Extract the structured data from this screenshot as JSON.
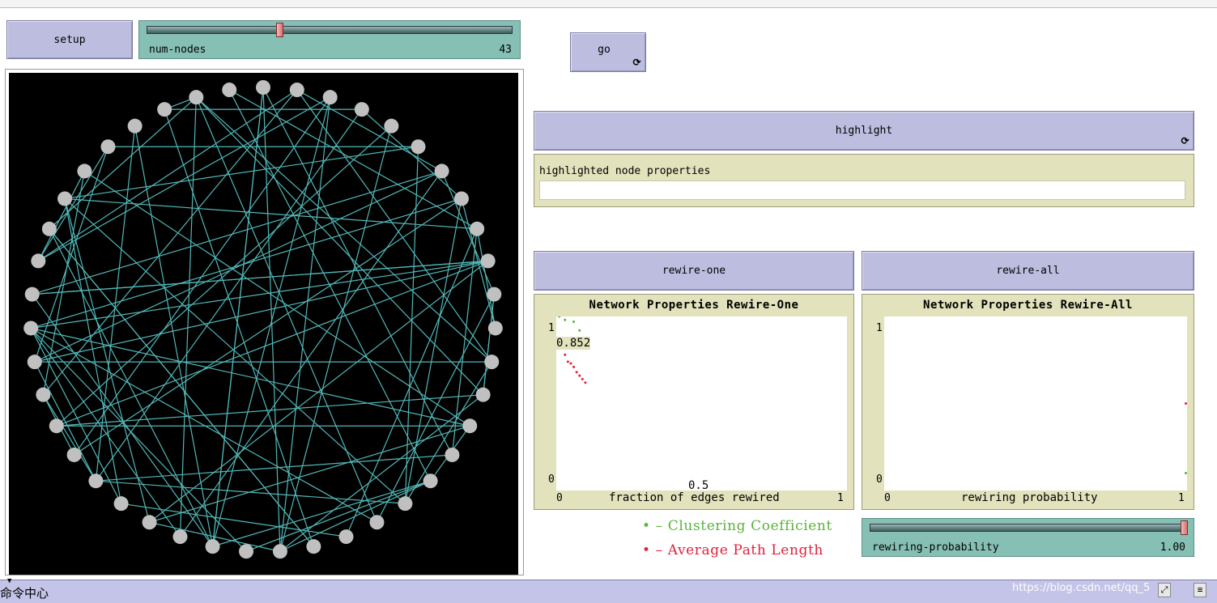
{
  "buttons": {
    "setup": "setup",
    "go": "go",
    "highlight": "highlight",
    "rewire_one": "rewire-one",
    "rewire_all": "rewire-all",
    "forever_icon": "forever-icon"
  },
  "sliders": {
    "num_nodes": {
      "label": "num-nodes",
      "value": "43",
      "fraction": 0.36
    },
    "rewiring_probability": {
      "label": "rewiring-probability",
      "value": "1.00",
      "fraction": 1.0
    }
  },
  "monitor": {
    "label": "highlighted node properties",
    "value": ""
  },
  "plots": [
    {
      "title": "Network Properties Rewire-One",
      "xlabel": "fraction of edges rewired",
      "x_min": "0",
      "x_max": "1",
      "y_min": "0",
      "y_max": "1",
      "annotations": [
        {
          "text": "0.852"
        },
        {
          "text": "0.5"
        }
      ]
    },
    {
      "title": "Network Properties Rewire-All",
      "xlabel": "rewiring probability",
      "x_min": "0",
      "x_max": "1",
      "y_min": "0",
      "y_max": "1"
    }
  ],
  "chart_data": [
    {
      "type": "scatter",
      "title": "Network Properties Rewire-One",
      "xlabel": "fraction of edges rewired",
      "ylabel": "",
      "xlim": [
        0,
        1
      ],
      "ylim": [
        0,
        1
      ],
      "series": [
        {
          "name": "Clustering Coefficient",
          "color": "#59b33c",
          "points": [
            [
              0.01,
              1.0
            ],
            [
              0.03,
              0.98
            ],
            [
              0.06,
              0.97
            ],
            [
              0.08,
              0.92
            ]
          ]
        },
        {
          "name": "Average Path Length",
          "color": "#e0203c",
          "points": [
            [
              0.03,
              0.78
            ],
            [
              0.04,
              0.74
            ],
            [
              0.05,
              0.73
            ],
            [
              0.06,
              0.71
            ],
            [
              0.07,
              0.68
            ],
            [
              0.08,
              0.66
            ],
            [
              0.09,
              0.64
            ],
            [
              0.1,
              0.62
            ]
          ]
        }
      ]
    },
    {
      "type": "scatter",
      "title": "Network Properties Rewire-All",
      "xlabel": "rewiring probability",
      "ylabel": "",
      "xlim": [
        0,
        1
      ],
      "ylim": [
        0,
        1
      ],
      "series": [
        {
          "name": "Clustering Coefficient",
          "color": "#59b33c",
          "points": [
            [
              1.0,
              0.1
            ]
          ]
        },
        {
          "name": "Average Path Length",
          "color": "#e0203c",
          "points": [
            [
              1.0,
              0.5
            ]
          ]
        }
      ]
    }
  ],
  "legend": [
    {
      "bullet": "•",
      "text": "– Clustering Coefficient",
      "color": "#59b33c"
    },
    {
      "bullet": "•",
      "text": "– Average Path Length",
      "color": "#e0203c"
    }
  ],
  "network": {
    "node_count": 43,
    "node_color": "#c0c0c0",
    "link_color": "#52b8b8",
    "background": "#000000"
  },
  "command_center": {
    "title": "命令中心"
  },
  "watermark": "https://blog.csdn.net/qq_5"
}
